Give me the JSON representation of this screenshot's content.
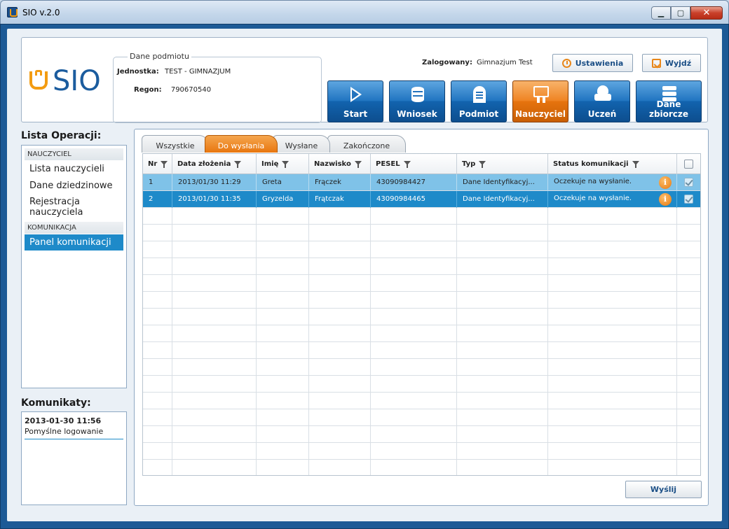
{
  "window": {
    "title": "SIO v.2.0",
    "min": "▁",
    "max": "▢",
    "close": "✕"
  },
  "logo": {
    "text": "SIO",
    "icon": "sio-shield-icon"
  },
  "entity": {
    "legend": "Dane podmiotu",
    "unit_label": "Jednostka:",
    "unit_value": "TEST - GIMNAZJUM",
    "regon_label": "Regon:",
    "regon_value": "790670540"
  },
  "user": {
    "label": "Zalogowany:",
    "value": "Gimnazjum Test"
  },
  "toolbar": {
    "settings_label": "Ustawienia",
    "settings_icon": "clock-icon",
    "exit_label": "Wyjdź",
    "exit_icon": "exit-icon"
  },
  "nav": [
    {
      "label": "Start",
      "icon": "play-icon",
      "active": false
    },
    {
      "label": "Wniosek",
      "icon": "database-icon",
      "active": false
    },
    {
      "label": "Podmiot",
      "icon": "building-icon",
      "active": false
    },
    {
      "label": "Nauczyciel",
      "icon": "teacher-icon",
      "active": true
    },
    {
      "label": "Uczeń",
      "icon": "student-icon",
      "active": false
    },
    {
      "label": "Dane zbiorcze",
      "icon": "books-icon",
      "active": false
    }
  ],
  "operations": {
    "title": "Lista Operacji:",
    "section1": "NAUCZYCIEL",
    "items1": [
      "Lista nauczycieli",
      "Dane dziedzinowe",
      "Rejestracja nauczyciela"
    ],
    "section2": "KOMUNIKACJA",
    "items2": [
      "Panel komunikacji"
    ]
  },
  "messages": {
    "title": "Komunikaty:",
    "entries": [
      {
        "time": "2013-01-30 11:56",
        "text": "Pomyślne logowanie"
      }
    ]
  },
  "tabs": [
    {
      "label": "Wszystkie",
      "active": false
    },
    {
      "label": "Do wysłania",
      "active": true
    },
    {
      "label": "Wysłane",
      "active": false
    },
    {
      "label": "Zakończone",
      "active": false
    }
  ],
  "table": {
    "columns": [
      "Nr",
      "Data złożenia",
      "Imię",
      "Nazwisko",
      "PESEL",
      "Typ",
      "Status komunikacji"
    ],
    "rows": [
      {
        "nr": "1",
        "date": "2013/01/30 11:29",
        "first": "Greta",
        "last": "Frączek",
        "pesel": "43090984427",
        "type": "Dane Identyfikacyj...",
        "status": "Oczekuje na wysłanie."
      },
      {
        "nr": "2",
        "date": "2013/01/30 11:35",
        "first": "Gryzelda",
        "last": "Frątczak",
        "pesel": "43090984465",
        "type": "Dane Identyfikacyj...",
        "status": "Oczekuje na wysłanie."
      }
    ],
    "info_icon": "i"
  },
  "send_label": "Wyślij",
  "colors": {
    "accent": "#1e8ac9",
    "orange": "#e8760f",
    "frame": "#1d5a96",
    "brand": "#1b5c9e"
  }
}
